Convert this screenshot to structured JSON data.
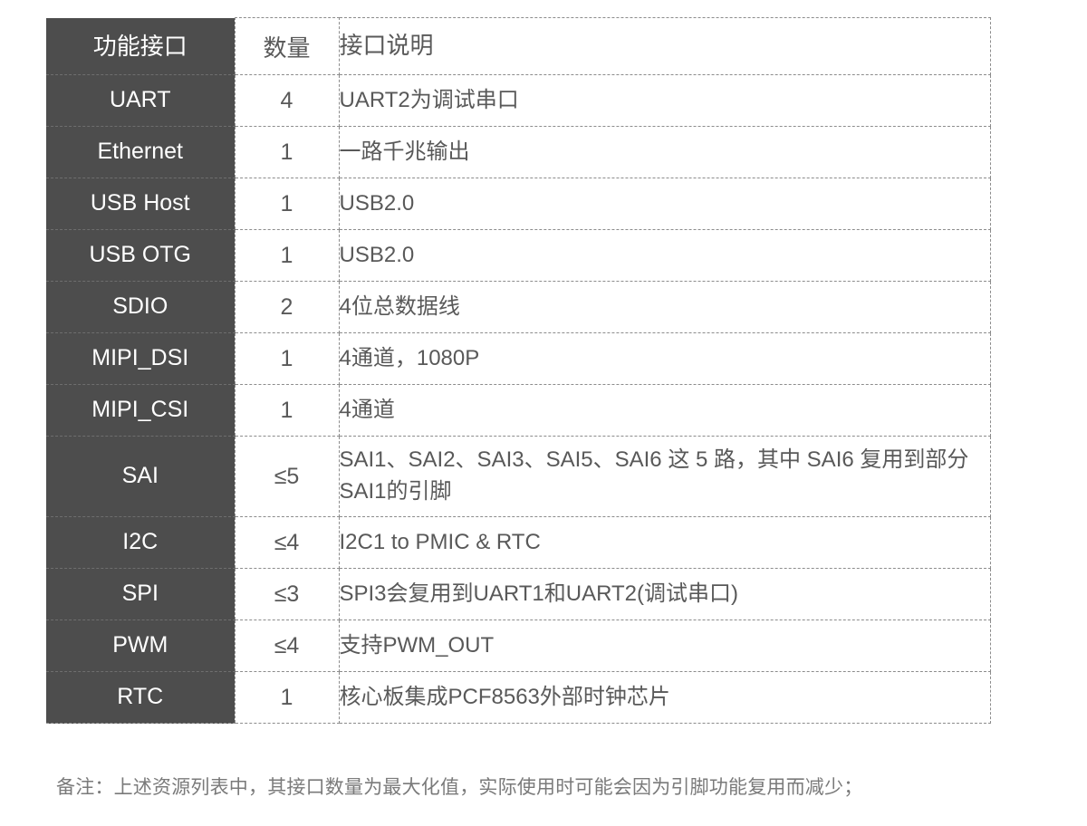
{
  "table": {
    "headers": {
      "name": "功能接口",
      "quantity": "数量",
      "description": "接口说明"
    },
    "rows": [
      {
        "name": "UART",
        "quantity": "4",
        "description": "UART2为调试串口"
      },
      {
        "name": "Ethernet",
        "quantity": "1",
        "description": "一路千兆输出"
      },
      {
        "name": "USB Host",
        "quantity": "1",
        "description": "USB2.0"
      },
      {
        "name": "USB OTG",
        "quantity": "1",
        "description": "USB2.0"
      },
      {
        "name": "SDIO",
        "quantity": "2",
        "description": "4位总数据线"
      },
      {
        "name": "MIPI_DSI",
        "quantity": "1",
        "description": "4通道，1080P"
      },
      {
        "name": "MIPI_CSI",
        "quantity": "1",
        "description": "4通道"
      },
      {
        "name": "SAI",
        "quantity": "≤5",
        "description": "SAI1、SAI2、SAI3、SAI5、SAI6 这 5 路，其中 SAI6 复用到部分SAI1的引脚"
      },
      {
        "name": "I2C",
        "quantity": "≤4",
        "description": "I2C1 to PMIC & RTC"
      },
      {
        "name": "SPI",
        "quantity": "≤3",
        "description": "SPI3会复用到UART1和UART2(调试串口)"
      },
      {
        "name": "PWM",
        "quantity": "≤4",
        "description": "支持PWM_OUT"
      },
      {
        "name": "RTC",
        "quantity": "1",
        "description": "核心板集成PCF8563外部时钟芯片"
      }
    ]
  },
  "footer": {
    "note": "备注：上述资源列表中，其接口数量为最大化值，实际使用时可能会因为引脚功能复用而减少；"
  },
  "colors": {
    "name_column_background": "#4d4d4d",
    "name_column_text": "#ffffff",
    "body_text": "#595959",
    "grid_line": "#8c8c8c",
    "page_background": "#ffffff",
    "footer_text": "#7a7a7a"
  }
}
